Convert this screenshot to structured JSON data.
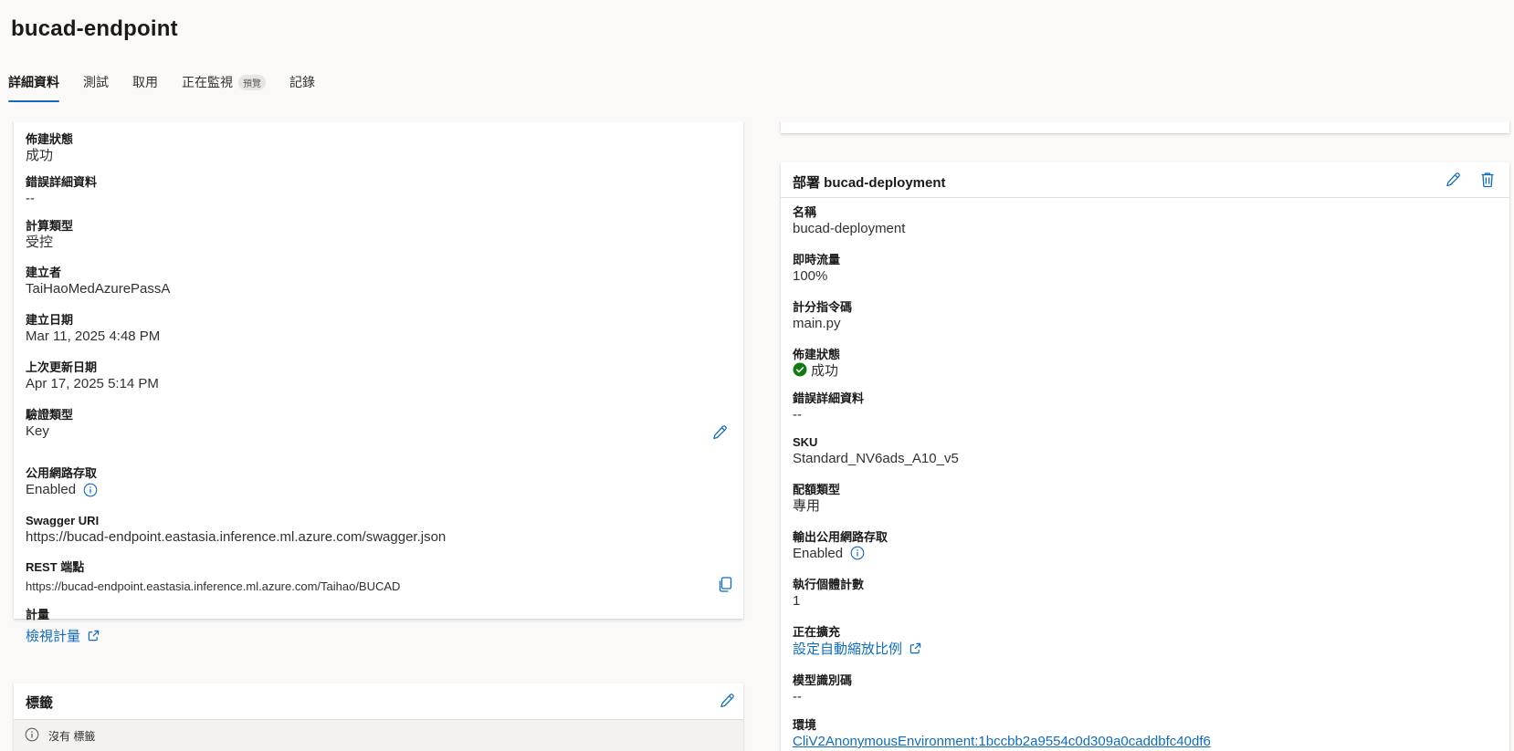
{
  "page": {
    "title": "bucad-endpoint"
  },
  "tabs": [
    {
      "label": "詳細資料",
      "active": true
    },
    {
      "label": "測試"
    },
    {
      "label": "取用"
    },
    {
      "label": "正在監視",
      "badge": "預覽"
    },
    {
      "label": "記錄"
    }
  ],
  "endpoint_details": {
    "provision_state": {
      "label": "佈建狀態",
      "value": "成功"
    },
    "error_details": {
      "label": "錯誤詳細資料",
      "value": "--"
    },
    "compute_type": {
      "label": "計算類型",
      "value": "受控"
    },
    "created_by": {
      "label": "建立者",
      "value": "TaiHaoMedAzurePassA"
    },
    "created_on": {
      "label": "建立日期",
      "value": "Mar 11, 2025 4:48 PM"
    },
    "last_updated": {
      "label": "上次更新日期",
      "value": "Apr 17, 2025 5:14 PM"
    },
    "auth_type": {
      "label": "驗證類型",
      "value": "Key"
    },
    "public_network": {
      "label": "公用網路存取",
      "value": "Enabled"
    },
    "swagger": {
      "label": "Swagger URI",
      "value": "https://bucad-endpoint.eastasia.inference.ml.azure.com/swagger.json"
    },
    "rest": {
      "label": "REST 端點",
      "value": "https://bucad-endpoint.eastasia.inference.ml.azure.com/Taihao/BUCAD"
    },
    "metrics": {
      "label": "計量",
      "link": "檢視計量"
    }
  },
  "tags_card": {
    "title": "標籤",
    "empty_text": "沒有 標籤"
  },
  "deployment": {
    "title": "部署 bucad-deployment",
    "name": {
      "label": "名稱",
      "value": "bucad-deployment"
    },
    "traffic": {
      "label": "即時流量",
      "value": "100%"
    },
    "scoring_script": {
      "label": "計分指令碼",
      "value": "main.py"
    },
    "provision_state": {
      "label": "佈建狀態",
      "value": "成功"
    },
    "error_details": {
      "label": "錯誤詳細資料",
      "value": "--"
    },
    "sku": {
      "label": "SKU",
      "value": "Standard_NV6ads_A10_v5"
    },
    "quota_type": {
      "label": "配額類型",
      "value": "專用"
    },
    "egress_public": {
      "label": "輸出公用網路存取",
      "value": "Enabled"
    },
    "instance_count": {
      "label": "執行個體計數",
      "value": "1"
    },
    "scaling": {
      "label": "正在擴充",
      "link": "設定自動縮放比例"
    },
    "model_id": {
      "label": "模型識別碼",
      "value": "--"
    },
    "environment": {
      "label": "環境",
      "link": "CliV2AnonymousEnvironment:1bccbb2a9554c0d309a0caddbfc40df6"
    }
  },
  "colors": {
    "accent": "#0f6cbd",
    "success": "#107c10"
  },
  "icons": [
    "edit-icon",
    "delete-icon",
    "copy-icon",
    "info-icon",
    "external-link-icon",
    "success-check-icon"
  ]
}
